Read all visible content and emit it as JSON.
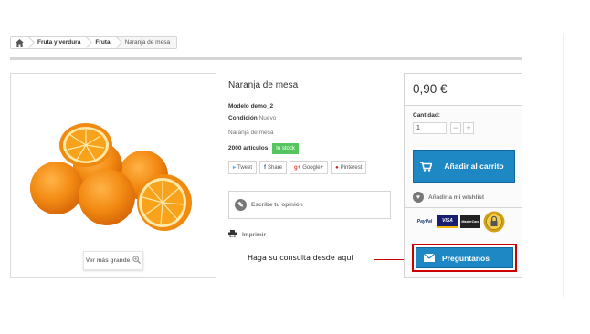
{
  "breadcrumb": {
    "home_icon": "home-icon",
    "items": [
      "Fruta y verdura",
      "Fruta"
    ],
    "current": "Naranja de mesa"
  },
  "product": {
    "title": "Naranja de mesa",
    "model_label": "Modelo",
    "model_value": "demo_2",
    "condition_label": "Condición",
    "condition_value": "Nuevo",
    "short_description": "Naranja de mesa",
    "stock_count": "2000 artículos",
    "stock_badge": "In stock",
    "zoom_label": "Ver más grande"
  },
  "social": [
    {
      "icon": "twitter-icon",
      "glyph": "🐦",
      "label": "Tweet"
    },
    {
      "icon": "facebook-icon",
      "glyph": "f",
      "label": "Share"
    },
    {
      "icon": "google-plus-icon",
      "glyph": "g+",
      "label": "Google+"
    },
    {
      "icon": "pinterest-icon",
      "glyph": "●",
      "label": "Pinterest"
    }
  ],
  "review": {
    "label": "Escribe tu opinión"
  },
  "print": {
    "label": "Imprimir"
  },
  "buy": {
    "price": "0,90 €",
    "quantity_label": "Cantidad:",
    "quantity_value": "1",
    "minus": "−",
    "plus": "+",
    "add_to_cart": "Añadir al carrito",
    "wishlist": "Añadir a mi wishlist",
    "payment_logos": [
      "PayPal",
      "VISA",
      "MasterCard",
      "Secure"
    ]
  },
  "ask": {
    "button": "Pregúntanos"
  },
  "annotation": {
    "text": "Haga su consulta desde aquí"
  },
  "colors": {
    "accent": "#1e88c5",
    "stock_green": "#55c65e",
    "highlight_red": "#cc0000"
  }
}
